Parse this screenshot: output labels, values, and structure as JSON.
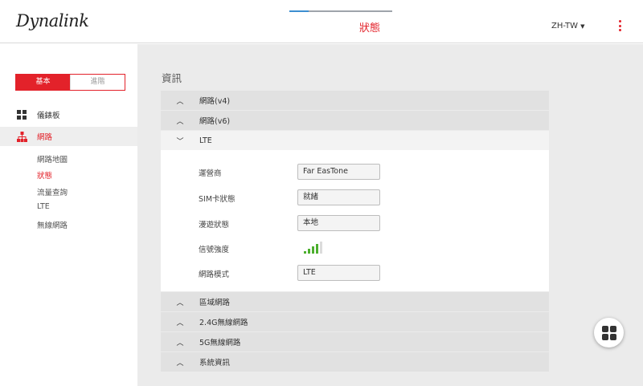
{
  "header": {
    "logo": "Dynalink",
    "title": "狀態",
    "language": "ZH-TW"
  },
  "sidebar": {
    "mode": {
      "basic": "基本",
      "advanced": "進階"
    },
    "nav": [
      {
        "label": "儀錶板",
        "icon": "dashboard-icon"
      },
      {
        "label": "網路",
        "icon": "network-icon"
      }
    ],
    "subnav": [
      "網路地圖",
      "狀態",
      "流量查詢",
      "LTE",
      "無線網路"
    ]
  },
  "main": {
    "section_title": "資訊",
    "accordions_top": [
      "網路(v4)",
      "網路(v6)"
    ],
    "lte": {
      "label": "LTE",
      "fields": {
        "carrier_label": "運營商",
        "carrier_value": "Far EasTone",
        "sim_label": "SIM卡狀態",
        "sim_value": "就緒",
        "roaming_label": "漫遊狀態",
        "roaming_value": "本地",
        "signal_label": "信號強度",
        "signal_bars": 4,
        "signal_max": 5,
        "mode_label": "網路模式",
        "mode_value": "LTE"
      }
    },
    "accordions_bottom": [
      "區域網路",
      "2.4G無線網路",
      "5G無線網路",
      "系統資訊"
    ]
  },
  "colors": {
    "brand_red": "#e3222a",
    "signal_green": "#4caf2e"
  }
}
